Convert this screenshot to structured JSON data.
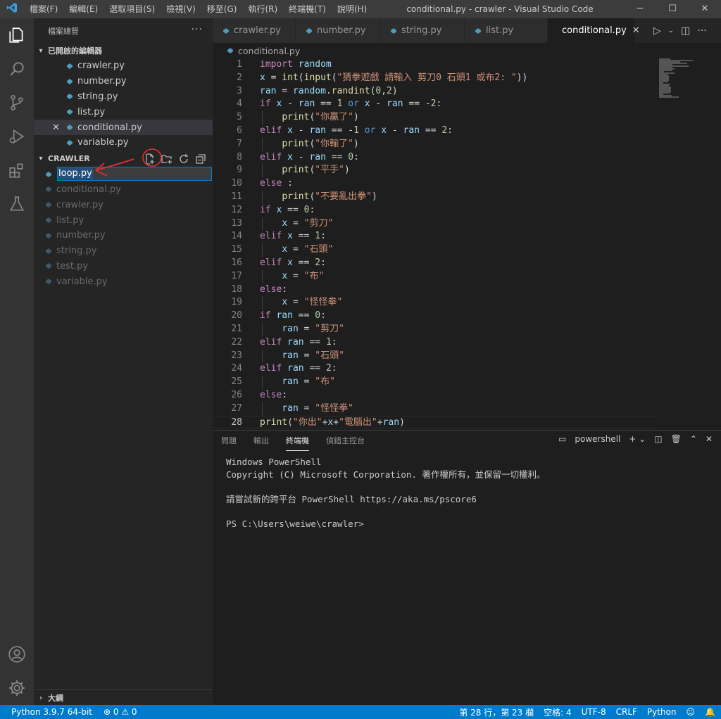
{
  "window": {
    "title": "conditional.py - crawler - Visual Studio Code",
    "menu": [
      "檔案(F)",
      "編輯(E)",
      "選取項目(S)",
      "檢視(V)",
      "移至(G)",
      "執行(R)",
      "終端機(T)",
      "說明(H)"
    ],
    "controls": [
      "─",
      "☐",
      "✕"
    ]
  },
  "activity_bar": [
    "explorer-icon",
    "search-icon",
    "source-control-icon",
    "run-debug-icon",
    "extensions-icon",
    "testing-icon",
    "account-icon",
    "settings-gear-icon"
  ],
  "sidebar": {
    "title": "檔案總管",
    "more": "···",
    "open_editors": {
      "header": "已開啟的編輯器",
      "items": [
        {
          "name": "crawler.py"
        },
        {
          "name": "number.py"
        },
        {
          "name": "string.py"
        },
        {
          "name": "list.py"
        },
        {
          "name": "conditional.py",
          "selected": true,
          "close": "✕"
        },
        {
          "name": "variable.py"
        }
      ]
    },
    "workspace": {
      "header": "CRAWLER",
      "rename_value": "loop.py",
      "files": [
        "conditional.py",
        "crawler.py",
        "list.py",
        "number.py",
        "string.py",
        "test.py",
        "variable.py"
      ]
    },
    "outline": {
      "header": "大綱"
    }
  },
  "tabs": [
    {
      "label": "crawler.py"
    },
    {
      "label": "number.py"
    },
    {
      "label": "string.py"
    },
    {
      "label": "list.py"
    },
    {
      "label": "conditional.py",
      "active": true,
      "close": "✕"
    }
  ],
  "breadcrumb": "conditional.py",
  "editor": {
    "lines": [
      {
        "n": "1",
        "t": "import random"
      },
      {
        "n": "2",
        "t": "x = int(input(\"猜拳遊戲 請輸入 剪刀0 石頭1 或布2: \"))"
      },
      {
        "n": "3",
        "t": "ran = random.randint(0,2)"
      },
      {
        "n": "4",
        "t": "if x - ran == 1 or x - ran == -2:"
      },
      {
        "n": "5",
        "t": "    print(\"你贏了\")"
      },
      {
        "n": "6",
        "t": "elif x - ran == -1 or x - ran == 2:"
      },
      {
        "n": "7",
        "t": "    print(\"你輸了\")"
      },
      {
        "n": "8",
        "t": "elif x - ran == 0:"
      },
      {
        "n": "9",
        "t": "    print(\"平手\")"
      },
      {
        "n": "10",
        "t": "else :"
      },
      {
        "n": "11",
        "t": "    print(\"不要亂出拳\")"
      },
      {
        "n": "12",
        "t": "if x == 0:"
      },
      {
        "n": "13",
        "t": "    x = \"剪刀\""
      },
      {
        "n": "14",
        "t": "elif x == 1:"
      },
      {
        "n": "15",
        "t": "    x = \"石頭\""
      },
      {
        "n": "16",
        "t": "elif x == 2:"
      },
      {
        "n": "17",
        "t": "    x = \"布\""
      },
      {
        "n": "18",
        "t": "else:"
      },
      {
        "n": "19",
        "t": "    x = \"怪怪拳\""
      },
      {
        "n": "20",
        "t": "if ran == 0:"
      },
      {
        "n": "21",
        "t": "    ran = \"剪刀\""
      },
      {
        "n": "22",
        "t": "elif ran == 1:"
      },
      {
        "n": "23",
        "t": "    ran = \"石頭\""
      },
      {
        "n": "24",
        "t": "elif ran == 2:"
      },
      {
        "n": "25",
        "t": "    ran = \"布\""
      },
      {
        "n": "26",
        "t": "else:"
      },
      {
        "n": "27",
        "t": "    ran = \"怪怪拳\""
      },
      {
        "n": "28",
        "t": "print(\"你出\"+x+\"電腦出\"+ran)"
      }
    ],
    "current_line": 28
  },
  "panel": {
    "tabs": [
      "問題",
      "輸出",
      "終端機",
      "偵錯主控台"
    ],
    "active_tab": "終端機",
    "shell_label": "powershell",
    "terminal_lines": [
      "Windows PowerShell",
      "Copyright (C) Microsoft Corporation. 著作權所有，並保留一切權利。",
      "",
      "請嘗試新的跨平台 PowerShell https://aka.ms/pscore6",
      "",
      "PS C:\\Users\\weiwe\\crawler>"
    ]
  },
  "statusbar": {
    "python": "Python 3.9.7 64-bit",
    "problems": "⊗ 0 ⚠ 0",
    "position": "第 28 行，第 23 欄",
    "spaces": "空格: 4",
    "encoding": "UTF-8",
    "eol": "CRLF",
    "language": "Python"
  },
  "colors": {
    "accent": "#007acc",
    "annotation": "#e03030",
    "python_icon": "#519aba"
  }
}
